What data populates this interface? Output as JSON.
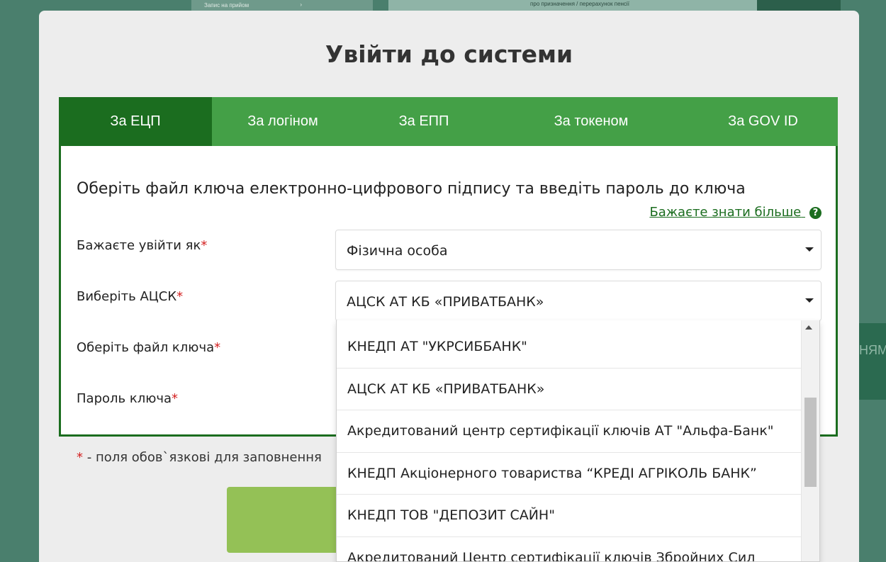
{
  "background": {
    "strip_text": "Запис на прийом",
    "strip_chevron": "›",
    "strip2_text": "про призначення / перерахунок пенсії",
    "right_button_text": "НЯМ"
  },
  "modal": {
    "title": "Увійти до системи",
    "tabs": [
      {
        "label": "За ЕЦП",
        "active": true
      },
      {
        "label": "За логіном",
        "active": false
      },
      {
        "label": "За ЕПП",
        "active": false
      },
      {
        "label": "За токеном",
        "active": false
      },
      {
        "label": "За GOV ID",
        "active": false
      }
    ],
    "panel": {
      "heading": "Оберіть файл ключа електронно-цифрового підпису та введіть пароль до ключа",
      "more_link": "Бажаєте знати більше",
      "more_icon": "?",
      "fields": {
        "login_as": {
          "label": "Бажаєте увійти як",
          "value": "Фізична особа"
        },
        "acsk": {
          "label": "Виберіть АЦСК",
          "value": "АЦСК АТ КБ «ПРИВАТБАНК»"
        },
        "key_file": {
          "label": "Оберіть файл ключа"
        },
        "key_password": {
          "label": "Пароль ключа"
        }
      },
      "required_marker": "*"
    },
    "required_note": " - поля обов`язкові для заповнення",
    "dropdown_options": [
      "КНЕДП АТ \"УКРСИББАНК\"",
      "АЦСК АТ КБ «ПРИВАТБАНК»",
      "Акредитований центр сертифікації ключів АТ \"Альфа-Банк\"",
      "КНЕДП Акціонерного товариства “КРЕДІ АГРІКОЛЬ БАНК”",
      "КНЕДП ТОВ \"ДЕПОЗИТ САЙН\"",
      "Акредитований Центр сертифікації ключів Збройних Сил"
    ]
  },
  "colors": {
    "tab_bar": "#44a047",
    "tab_active": "#1b6d1f",
    "submit": "#94c156",
    "required": "#d32020"
  }
}
